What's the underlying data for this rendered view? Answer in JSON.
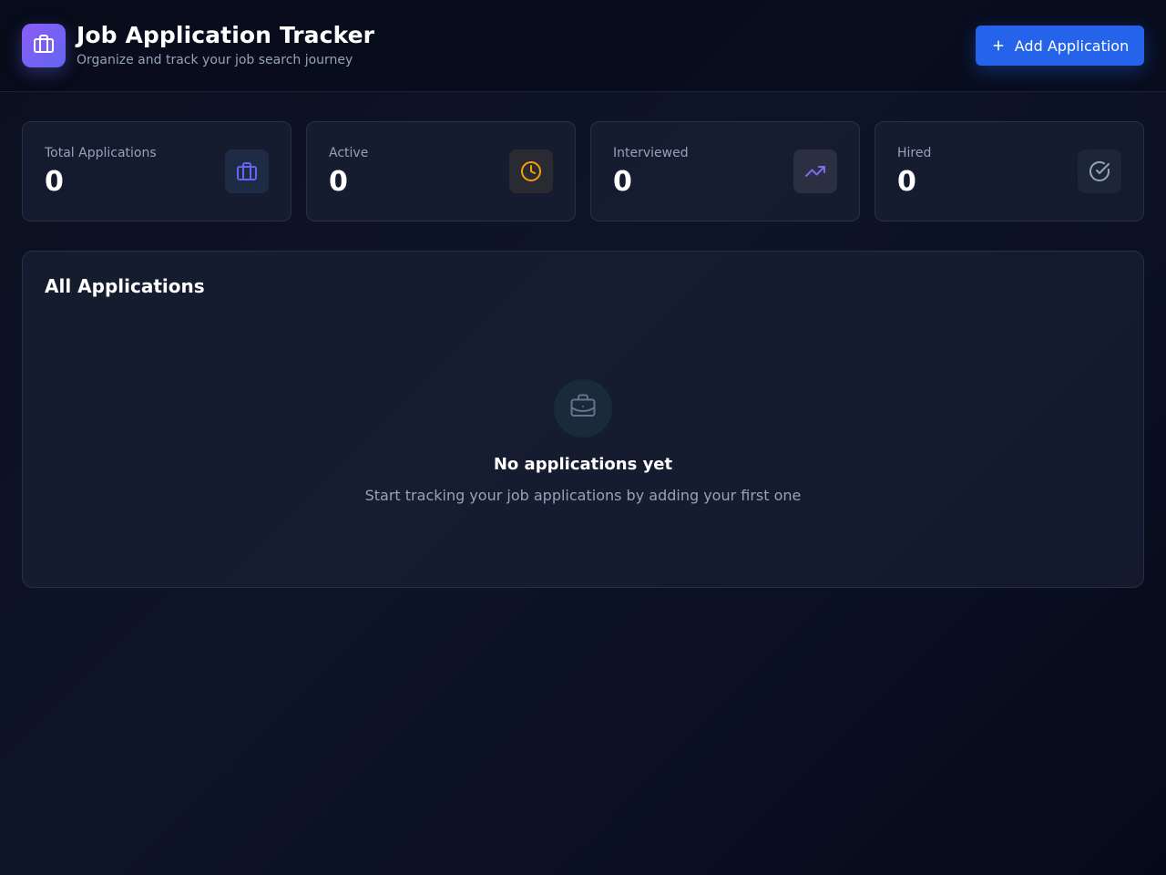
{
  "header": {
    "title": "Job Application Tracker",
    "subtitle": "Organize and track your job search journey",
    "add_button_label": "Add Application",
    "logo_icon": "briefcase-icon"
  },
  "stats": [
    {
      "label": "Total Applications",
      "value": "0",
      "icon": "briefcase-icon",
      "color": "#6366f1"
    },
    {
      "label": "Active",
      "value": "0",
      "icon": "clock-icon",
      "color": "#f59e0b"
    },
    {
      "label": "Interviewed",
      "value": "0",
      "icon": "trending-up-icon",
      "color": "#7c6cf0"
    },
    {
      "label": "Hired",
      "value": "0",
      "icon": "check-circle-icon",
      "color": "#94a3b8"
    }
  ],
  "applications": {
    "title": "All Applications",
    "empty_title": "No applications yet",
    "empty_description": "Start tracking your job applications by adding your first one",
    "empty_icon": "briefcase-icon"
  },
  "colors": {
    "accent": "#2563eb",
    "brand": "#6366f1",
    "background": "#0b1020"
  }
}
